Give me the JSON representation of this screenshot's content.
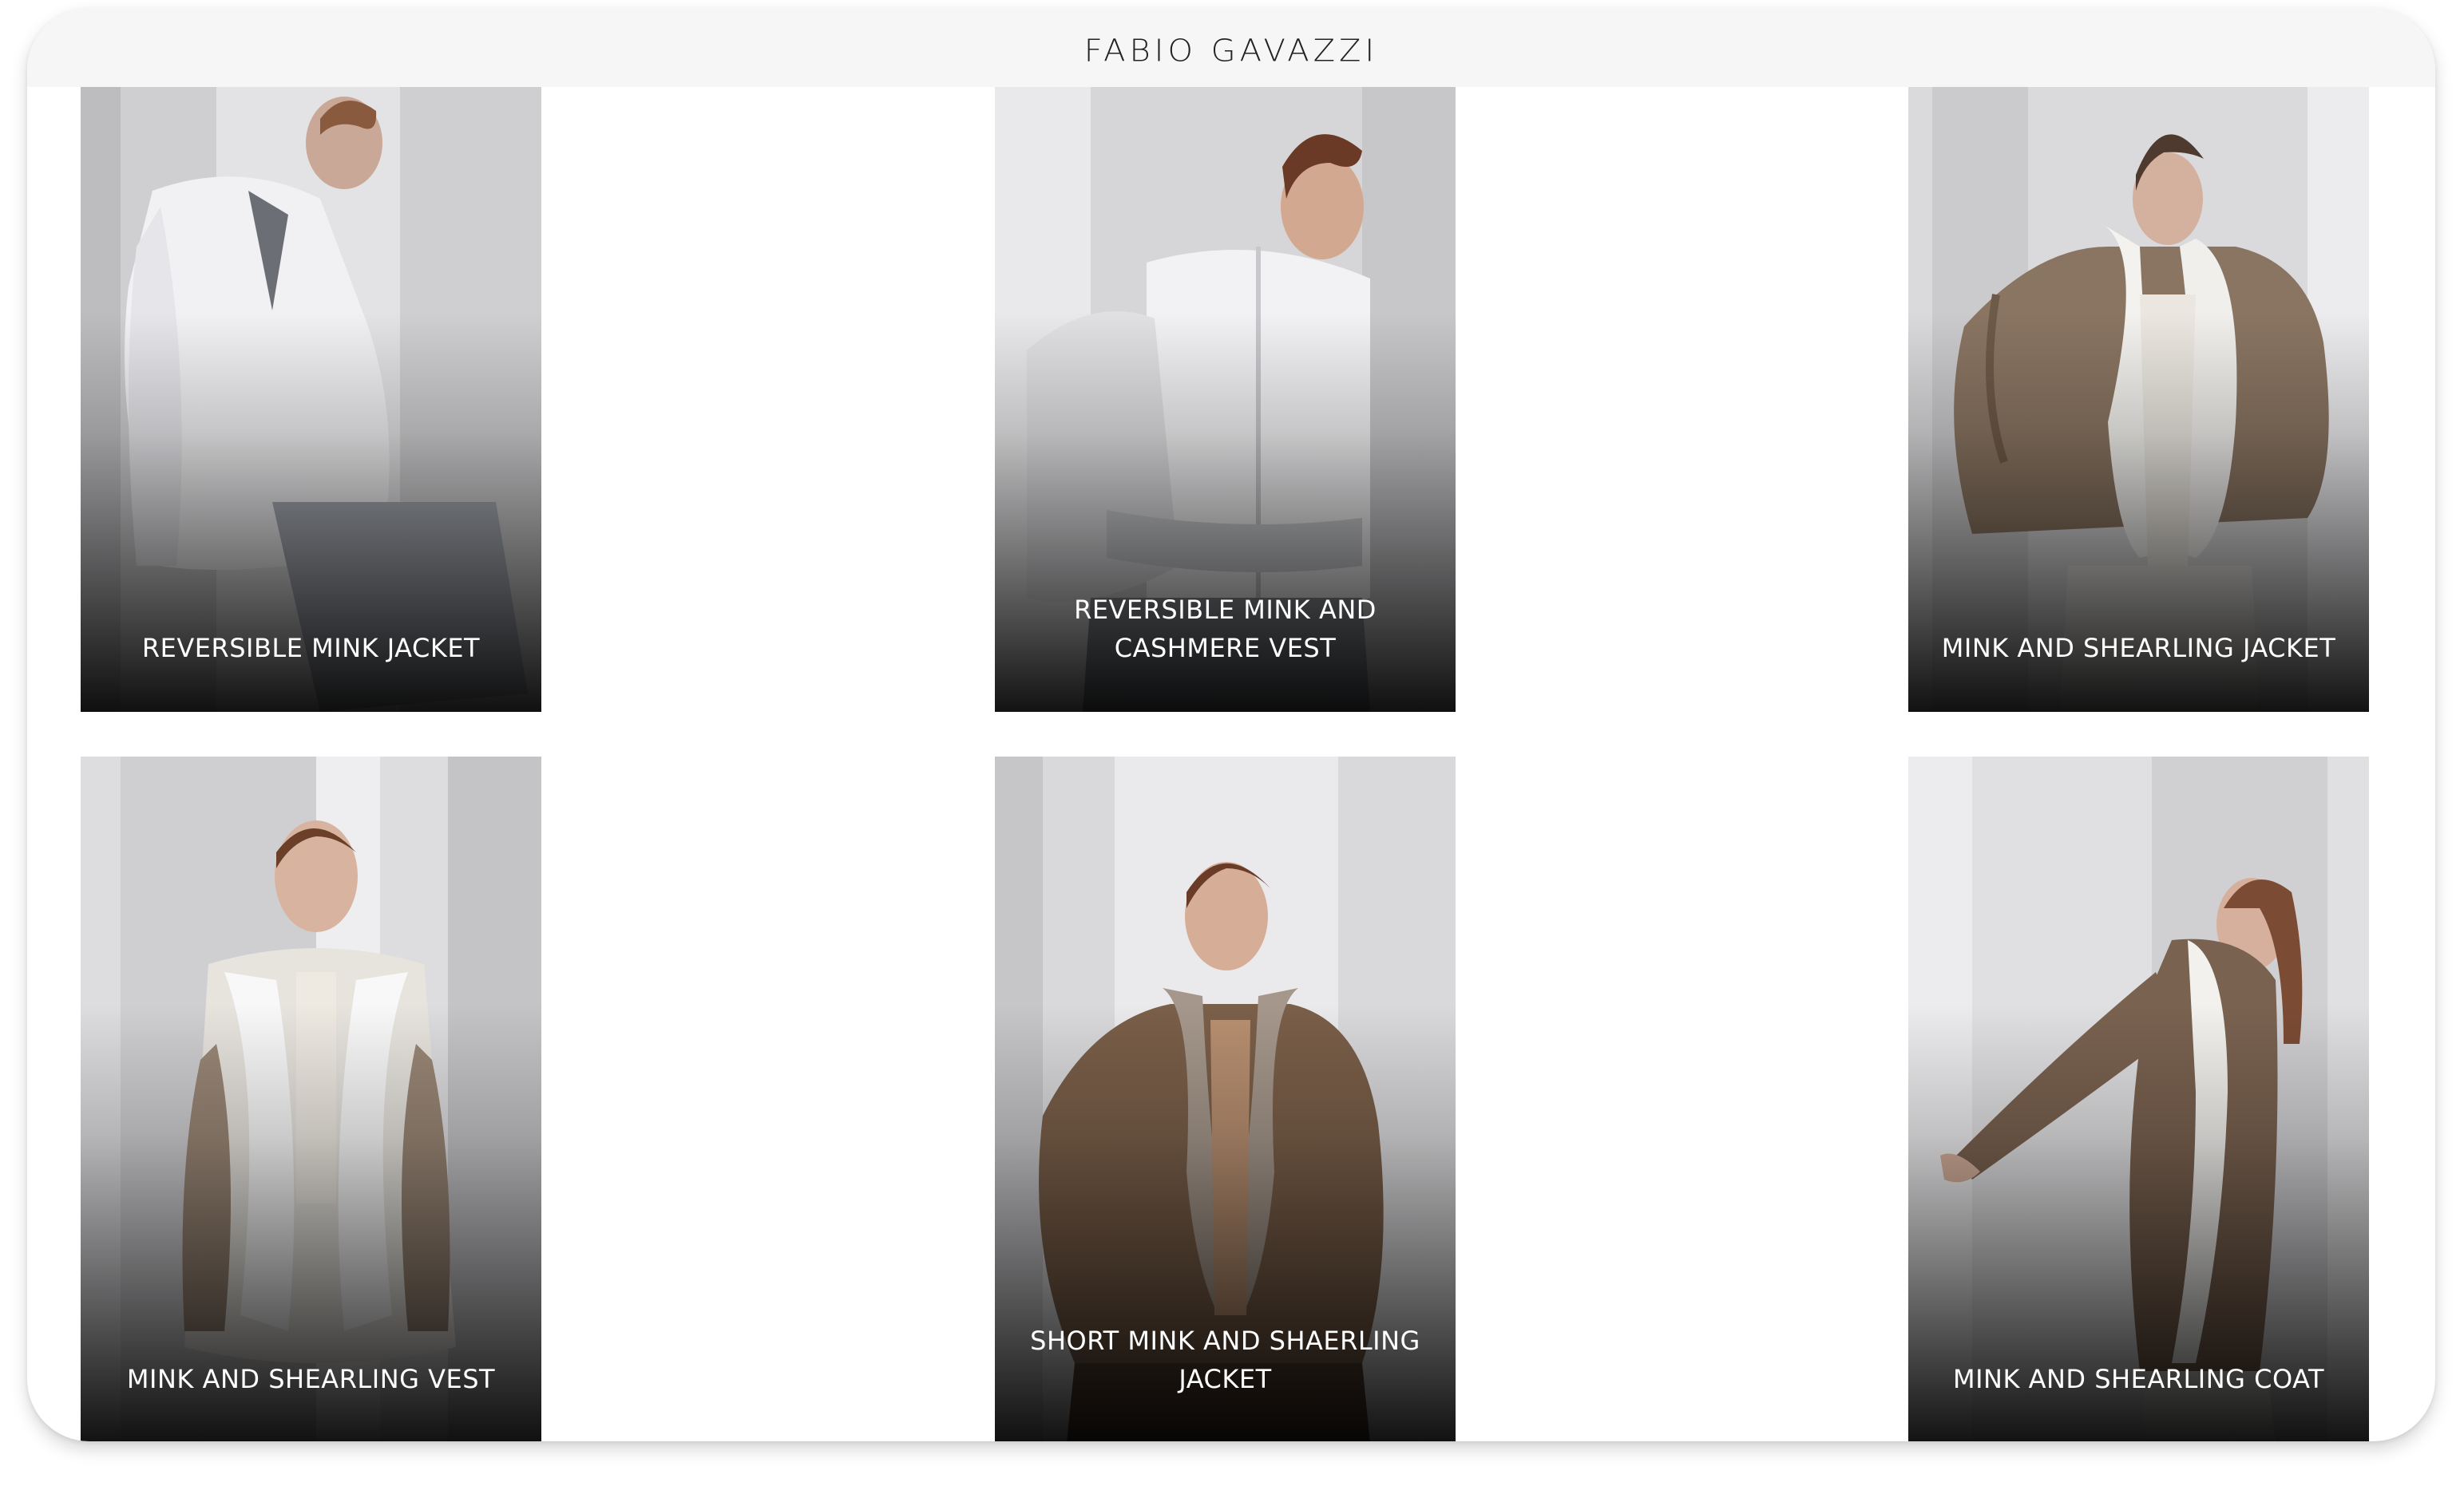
{
  "brand": {
    "logo_text": "FABIO GAVAZZI"
  },
  "products": [
    {
      "title": "REVERSIBLE MINK JACKET",
      "image": "model in white mink jacket seated"
    },
    {
      "title": "REVERSIBLE MINK AND CASHMERE VEST",
      "image": "model in white mink and cashmere vest"
    },
    {
      "title": "MINK AND SHEARLING JACKET",
      "image": "model in brown mink jacket with white shearling collar"
    },
    {
      "title": "MINK AND SHEARLING VEST",
      "image": "model in mink vest with white shearling front"
    },
    {
      "title": "SHORT MINK AND SHAERLING JACKET",
      "image": "model in brown mink jacket with grey shearling collar"
    },
    {
      "title": "MINK AND SHEARLING COAT",
      "image": "model leaning in long brown mink coat"
    }
  ]
}
